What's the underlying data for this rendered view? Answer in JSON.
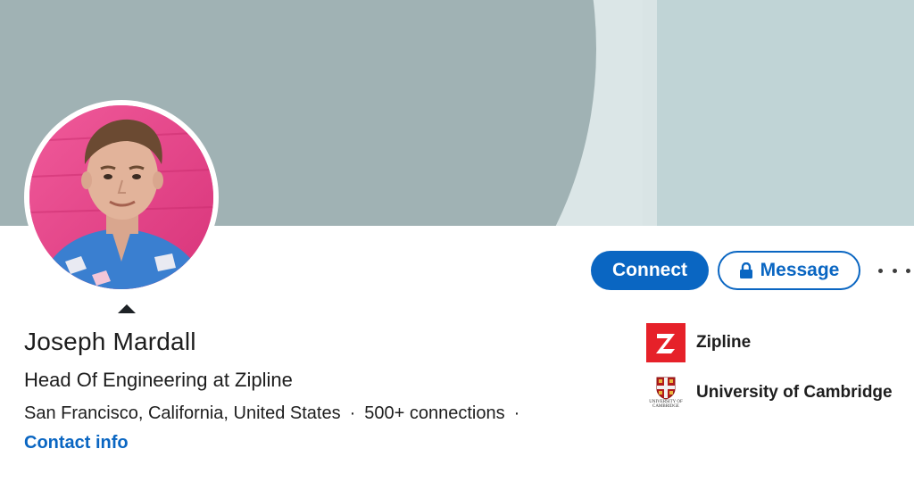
{
  "profile": {
    "name": "Joseph Mardall",
    "headline": "Head Of Engineering at Zipline",
    "location": "San Francisco, California, United States",
    "separator": "·",
    "connections": "500+ connections",
    "contact_info": "Contact info"
  },
  "actions": {
    "connect_label": "Connect",
    "message_label": "Message",
    "more_icon": "more-horizontal-icon",
    "lock_icon": "lock-icon"
  },
  "organizations": [
    {
      "name": "Zipline",
      "logo": "zipline-logo"
    },
    {
      "name": "University of Cambridge",
      "logo": "cambridge-crest-logo",
      "logo_text": "UNIVERSITY OF CAMBRIDGE"
    }
  ],
  "colors": {
    "accent": "#0a66c2",
    "banner_light": "#c0d4d6",
    "banner_dark": "#a0b2b4",
    "zipline_red": "#e62129",
    "avatar_bg": "#e5478a"
  }
}
